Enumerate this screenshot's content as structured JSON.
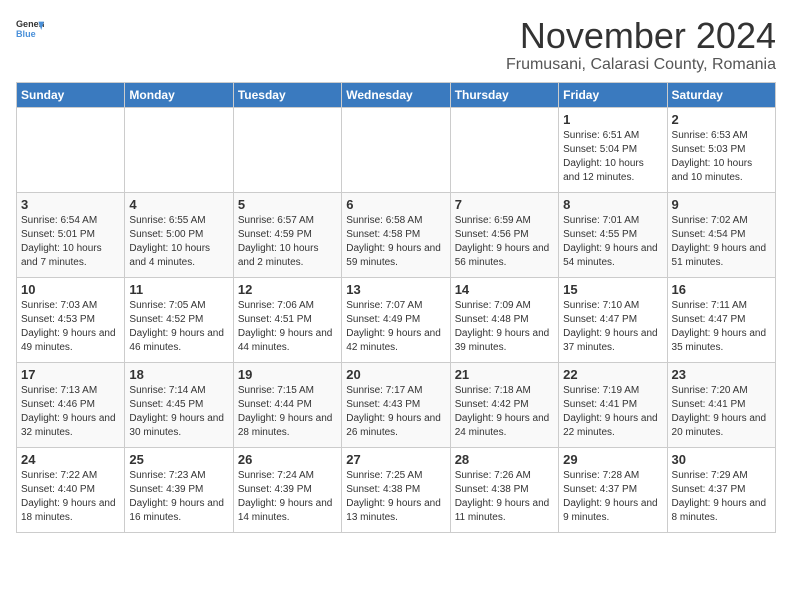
{
  "header": {
    "logo_general": "General",
    "logo_blue": "Blue",
    "title": "November 2024",
    "subtitle": "Frumusani, Calarasi County, Romania"
  },
  "weekdays": [
    "Sunday",
    "Monday",
    "Tuesday",
    "Wednesday",
    "Thursday",
    "Friday",
    "Saturday"
  ],
  "weeks": [
    [
      {
        "day": "",
        "info": ""
      },
      {
        "day": "",
        "info": ""
      },
      {
        "day": "",
        "info": ""
      },
      {
        "day": "",
        "info": ""
      },
      {
        "day": "",
        "info": ""
      },
      {
        "day": "1",
        "info": "Sunrise: 6:51 AM\nSunset: 5:04 PM\nDaylight: 10 hours and 12 minutes."
      },
      {
        "day": "2",
        "info": "Sunrise: 6:53 AM\nSunset: 5:03 PM\nDaylight: 10 hours and 10 minutes."
      }
    ],
    [
      {
        "day": "3",
        "info": "Sunrise: 6:54 AM\nSunset: 5:01 PM\nDaylight: 10 hours and 7 minutes."
      },
      {
        "day": "4",
        "info": "Sunrise: 6:55 AM\nSunset: 5:00 PM\nDaylight: 10 hours and 4 minutes."
      },
      {
        "day": "5",
        "info": "Sunrise: 6:57 AM\nSunset: 4:59 PM\nDaylight: 10 hours and 2 minutes."
      },
      {
        "day": "6",
        "info": "Sunrise: 6:58 AM\nSunset: 4:58 PM\nDaylight: 9 hours and 59 minutes."
      },
      {
        "day": "7",
        "info": "Sunrise: 6:59 AM\nSunset: 4:56 PM\nDaylight: 9 hours and 56 minutes."
      },
      {
        "day": "8",
        "info": "Sunrise: 7:01 AM\nSunset: 4:55 PM\nDaylight: 9 hours and 54 minutes."
      },
      {
        "day": "9",
        "info": "Sunrise: 7:02 AM\nSunset: 4:54 PM\nDaylight: 9 hours and 51 minutes."
      }
    ],
    [
      {
        "day": "10",
        "info": "Sunrise: 7:03 AM\nSunset: 4:53 PM\nDaylight: 9 hours and 49 minutes."
      },
      {
        "day": "11",
        "info": "Sunrise: 7:05 AM\nSunset: 4:52 PM\nDaylight: 9 hours and 46 minutes."
      },
      {
        "day": "12",
        "info": "Sunrise: 7:06 AM\nSunset: 4:51 PM\nDaylight: 9 hours and 44 minutes."
      },
      {
        "day": "13",
        "info": "Sunrise: 7:07 AM\nSunset: 4:49 PM\nDaylight: 9 hours and 42 minutes."
      },
      {
        "day": "14",
        "info": "Sunrise: 7:09 AM\nSunset: 4:48 PM\nDaylight: 9 hours and 39 minutes."
      },
      {
        "day": "15",
        "info": "Sunrise: 7:10 AM\nSunset: 4:47 PM\nDaylight: 9 hours and 37 minutes."
      },
      {
        "day": "16",
        "info": "Sunrise: 7:11 AM\nSunset: 4:47 PM\nDaylight: 9 hours and 35 minutes."
      }
    ],
    [
      {
        "day": "17",
        "info": "Sunrise: 7:13 AM\nSunset: 4:46 PM\nDaylight: 9 hours and 32 minutes."
      },
      {
        "day": "18",
        "info": "Sunrise: 7:14 AM\nSunset: 4:45 PM\nDaylight: 9 hours and 30 minutes."
      },
      {
        "day": "19",
        "info": "Sunrise: 7:15 AM\nSunset: 4:44 PM\nDaylight: 9 hours and 28 minutes."
      },
      {
        "day": "20",
        "info": "Sunrise: 7:17 AM\nSunset: 4:43 PM\nDaylight: 9 hours and 26 minutes."
      },
      {
        "day": "21",
        "info": "Sunrise: 7:18 AM\nSunset: 4:42 PM\nDaylight: 9 hours and 24 minutes."
      },
      {
        "day": "22",
        "info": "Sunrise: 7:19 AM\nSunset: 4:41 PM\nDaylight: 9 hours and 22 minutes."
      },
      {
        "day": "23",
        "info": "Sunrise: 7:20 AM\nSunset: 4:41 PM\nDaylight: 9 hours and 20 minutes."
      }
    ],
    [
      {
        "day": "24",
        "info": "Sunrise: 7:22 AM\nSunset: 4:40 PM\nDaylight: 9 hours and 18 minutes."
      },
      {
        "day": "25",
        "info": "Sunrise: 7:23 AM\nSunset: 4:39 PM\nDaylight: 9 hours and 16 minutes."
      },
      {
        "day": "26",
        "info": "Sunrise: 7:24 AM\nSunset: 4:39 PM\nDaylight: 9 hours and 14 minutes."
      },
      {
        "day": "27",
        "info": "Sunrise: 7:25 AM\nSunset: 4:38 PM\nDaylight: 9 hours and 13 minutes."
      },
      {
        "day": "28",
        "info": "Sunrise: 7:26 AM\nSunset: 4:38 PM\nDaylight: 9 hours and 11 minutes."
      },
      {
        "day": "29",
        "info": "Sunrise: 7:28 AM\nSunset: 4:37 PM\nDaylight: 9 hours and 9 minutes."
      },
      {
        "day": "30",
        "info": "Sunrise: 7:29 AM\nSunset: 4:37 PM\nDaylight: 9 hours and 8 minutes."
      }
    ]
  ]
}
